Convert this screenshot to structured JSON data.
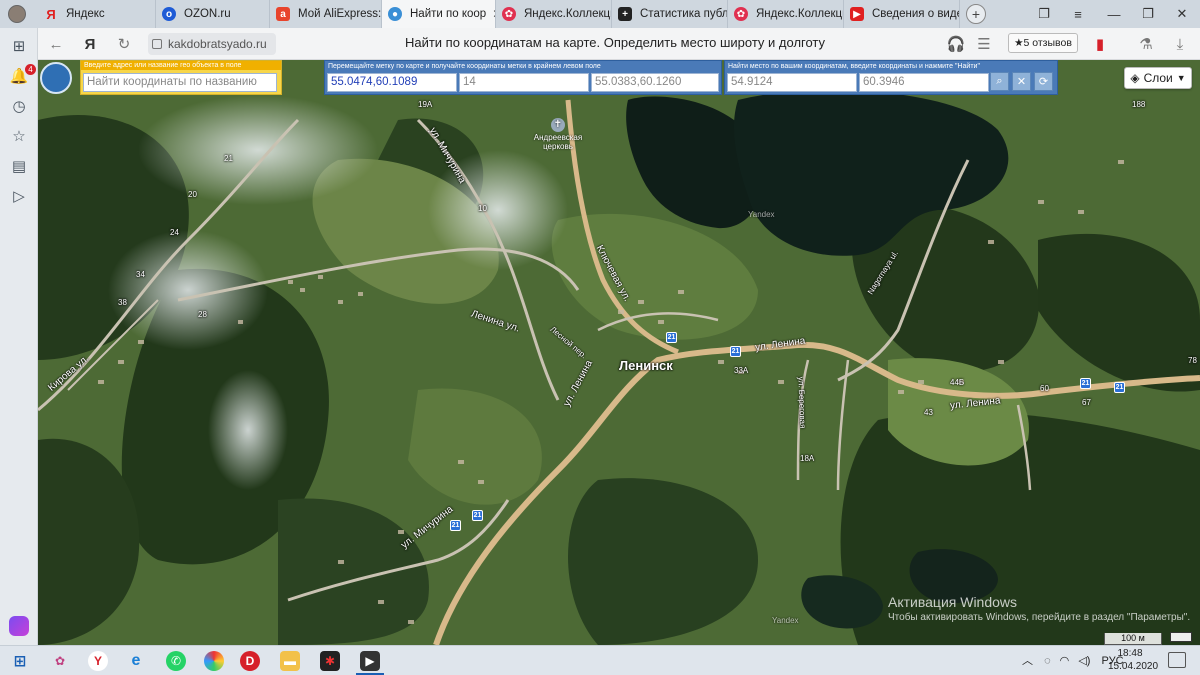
{
  "browser": {
    "tabs": [
      {
        "label": "Яндекс",
        "icon": "yandex-icon",
        "color": "#e02020"
      },
      {
        "label": "OZON.ru",
        "icon": "ozon-icon",
        "color": "#1e5bd6"
      },
      {
        "label": "Мой AliExpress: У",
        "icon": "aliexpress-icon",
        "color": "#e8442c"
      },
      {
        "label": "Найти по коор",
        "icon": "site-icon",
        "color": "#3a8fd6"
      },
      {
        "label": "Яндекс.Коллекци",
        "icon": "collections-icon",
        "color": "#e03050"
      },
      {
        "label": "Статистика публ",
        "icon": "plus-icon",
        "color": "#222222"
      },
      {
        "label": "Яндекс.Коллекци",
        "icon": "collections-icon",
        "color": "#e03050"
      },
      {
        "label": "Сведения о виде",
        "icon": "youtube-icon",
        "color": "#e02020"
      }
    ],
    "active_tab_index": 3,
    "new_tab": "+",
    "url": "kakdobratsyado.ru",
    "page_title": "Найти по координатам на карте. Определить место широту и долготу",
    "reviews": "★5 отзывов",
    "notification_count": "4"
  },
  "controls": {
    "search_title": "Введите адрес или название гео объекта в поле",
    "search_placeholder": "Найти координаты по названию",
    "marker_title": "Перемещайте метку по карте и получайте координаты метки в крайнем левом поле",
    "marker_coords": "55.0474,60.1089",
    "zoom": "14",
    "corner_coords": "55.0383,60.1260",
    "find_title": "Найти место по вашим координатам, введите координаты и нажмите \"Найти\"",
    "lat_value": "54.9124",
    "lon_value": "60.3946",
    "layers": "Слои"
  },
  "map": {
    "town": "Ленинск",
    "labels": [
      "ул. Ленина",
      "ул. Ленина",
      "ул. Ленина",
      "Ключевая ул.",
      "Ленина ул.",
      "Андреевская церковь",
      "ул. Мичурина",
      "Лесной пер.",
      "Кирова ул.",
      "ул. Мичурина",
      "ул. Береговая",
      "Nagornaya ul.",
      "Yandex",
      "Yandex"
    ],
    "numbers": [
      "19А",
      "60",
      "67",
      "43",
      "44Б",
      "33А",
      "18А",
      "188",
      "78",
      "10",
      "21",
      "20",
      "24",
      "34",
      "38",
      "28"
    ],
    "route_badge": "21",
    "scale": "100 м"
  },
  "system": {
    "activation_title": "Активация Windows",
    "activation_text": "Чтобы активировать Windows, перейдите в раздел \"Параметры\".",
    "lang": "РУС",
    "time": "18:48",
    "date": "15.04.2020"
  }
}
